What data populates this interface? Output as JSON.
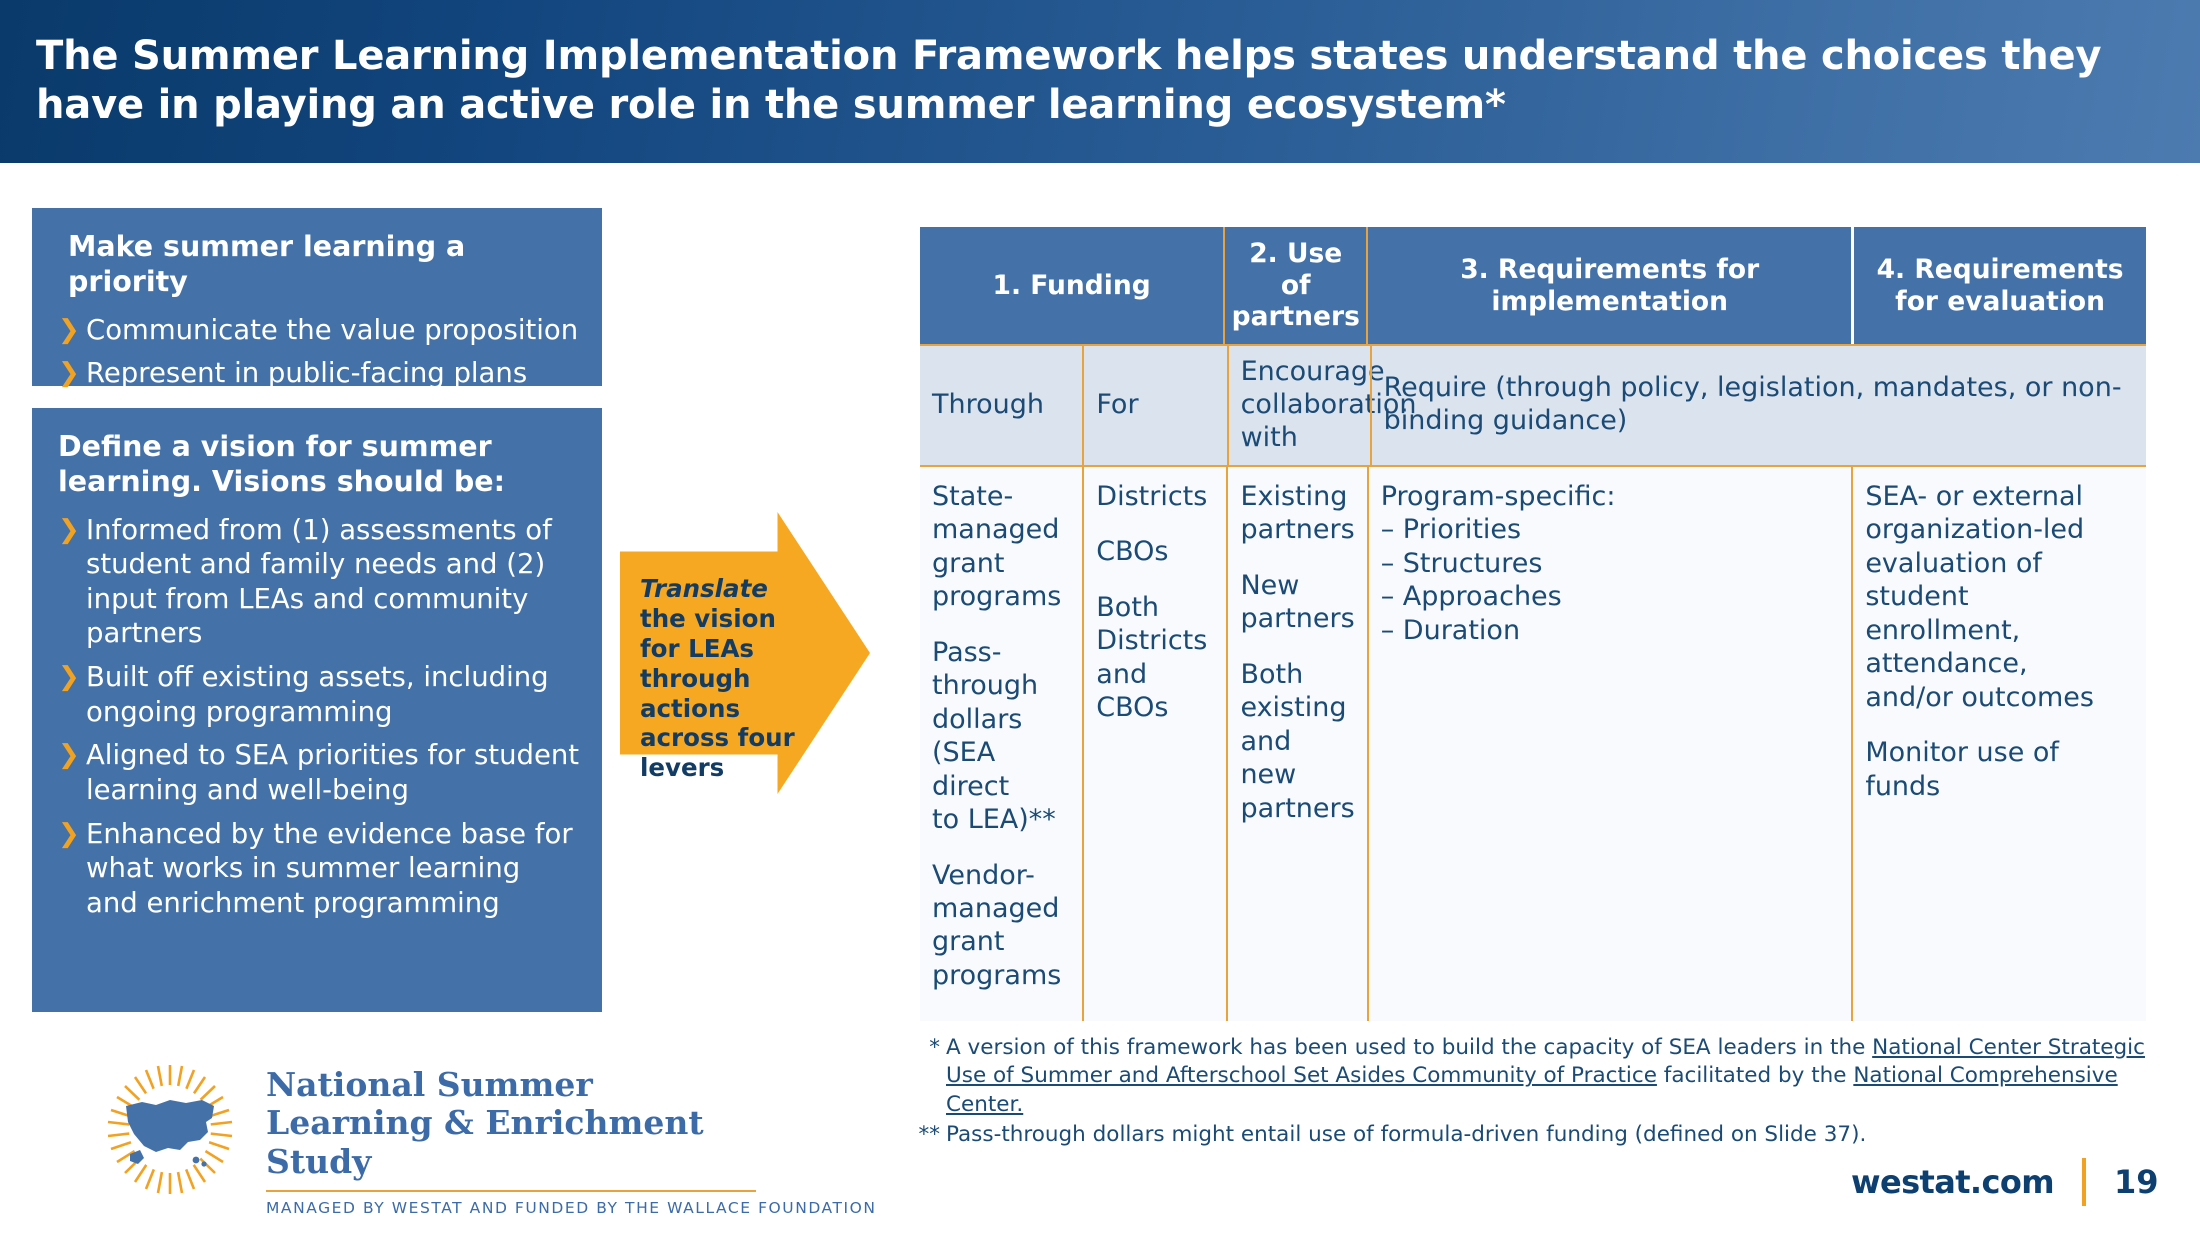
{
  "slide": {
    "title": "The Summer Learning Implementation Framework helps states understand the choices they have in playing an active role in the summer learning ecosystem*",
    "page_number": "19",
    "brand_url": "westat.com"
  },
  "colors": {
    "header_blue": "#4472a8",
    "title_navy": "#0a3a6b",
    "accent_orange": "#f7a823",
    "rule_orange": "#e8a33d",
    "cell_band": "#dbe3ef",
    "cell_body": "#f8fafd",
    "text_blue": "#1b4b75",
    "logo_blue": "#3c6ba8"
  },
  "panels": [
    {
      "heading": "Make summer learning a priority",
      "items": [
        "Communicate the value proposition",
        "Represent in public-facing plans"
      ]
    },
    {
      "heading": "Define a vision for summer learning. Visions should be:",
      "items": [
        "Informed from (1) assessments of student and family needs and (2) input from LEAs and community partners",
        "Built off existing assets, including ongoing programming",
        "Aligned to SEA priorities for student learning and well-being",
        "Enhanced by the evidence base for what works in summer learning and enrichment programming"
      ]
    }
  ],
  "arrow": {
    "emphasis": "Translate",
    "rest": "the vision for LEAs through actions across four levers"
  },
  "table": {
    "headers": [
      "1. Funding",
      "2. Use of partners",
      "3. Requirements for implementation",
      "4. Requirements for evaluation"
    ],
    "subheader_row": {
      "funding_through": "Through",
      "funding_for": "For",
      "partners": "Encourage collaboration with",
      "requirements": "Require (through policy, legislation, mandates, or non-binding guidance)"
    },
    "body_row": {
      "funding_through": [
        "State-\nmanaged\ngrant\nprograms",
        "Pass-\nthrough\ndollars\n(SEA direct\nto LEA)**",
        "Vendor-\nmanaged\ngrant\nprograms"
      ],
      "funding_for": [
        "Districts",
        "CBOs",
        "Both\nDistricts\nand CBOs"
      ],
      "partners": [
        "Existing\npartners",
        "New\npartners",
        "Both\nexisting\nand new\npartners"
      ],
      "implementation": [
        "Program-specific:\n– Priorities\n– Structures\n– Approaches\n– Duration"
      ],
      "evaluation": [
        "SEA- or external\norganization-led\nevaluation of student\nenrollment,\nattendance,\nand/or outcomes",
        "Monitor use of funds"
      ]
    }
  },
  "footnotes": {
    "one_mark": "*",
    "one_part1": "A version of this framework has been used to build the capacity of SEA leaders in the ",
    "one_link1": "National Center Strategic Use of Summer and Afterschool Set Asides Community of Practice",
    "one_part2": " facilitated by the ",
    "one_link2": "National Comprehensive Center.",
    "two_mark": "**",
    "two_text": "Pass-through dollars might entail use of formula-driven funding (defined on Slide 37)."
  },
  "logo": {
    "line1": "National Summer",
    "line2": "Learning & Enrichment Study",
    "tagline": "MANAGED BY WESTAT AND FUNDED BY THE WALLACE FOUNDATION"
  }
}
